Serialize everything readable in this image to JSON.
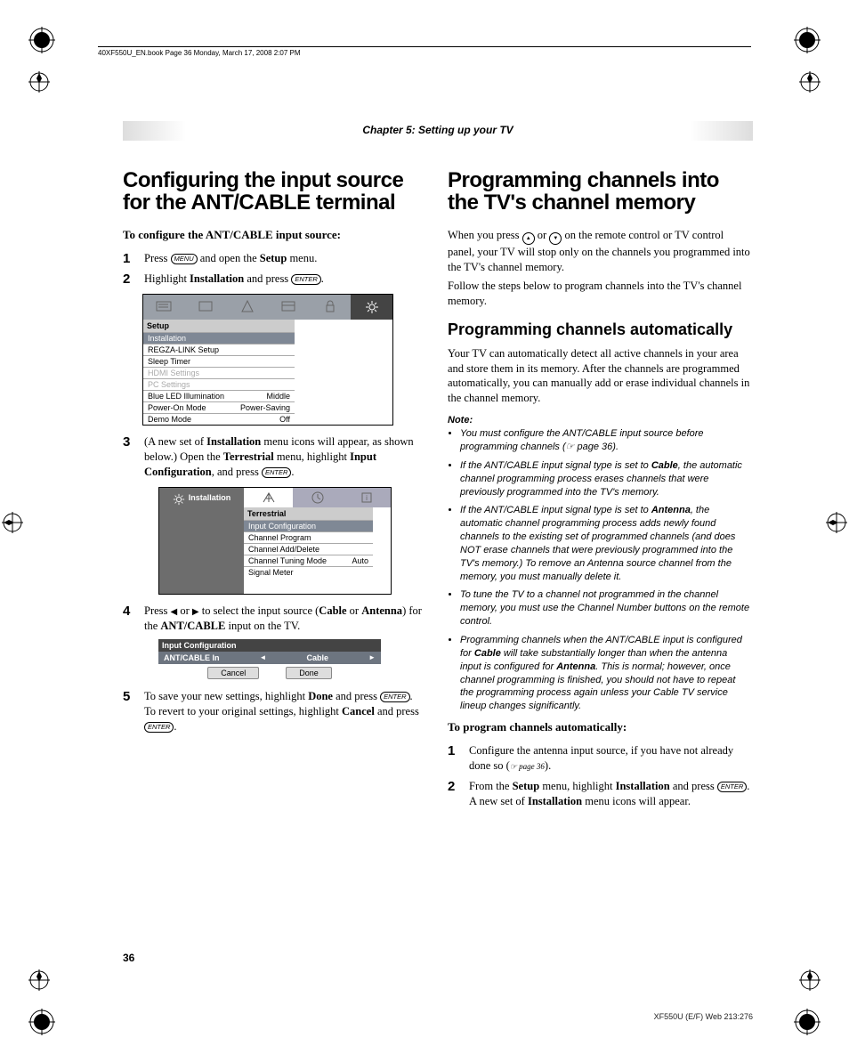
{
  "header": {
    "crop_text": "40XF550U_EN.book  Page 36  Monday, March 17, 2008  2:07 PM",
    "chapter": "Chapter 5: Setting up your TV"
  },
  "left": {
    "h1": "Configuring the input source for the ANT/CABLE terminal",
    "lede": "To configure the ANT/CABLE input source:",
    "step1_a": "Press ",
    "step1_menu": "MENU",
    "step1_b": " and open the ",
    "step1_bold": "Setup",
    "step1_c": " menu.",
    "step2_a": "Highlight ",
    "step2_bold": "Installation",
    "step2_b": " and press ",
    "step2_enter": "ENTER",
    "step2_c": ".",
    "menu1": {
      "title": "Setup",
      "rows": [
        {
          "l": "Installation",
          "r": "",
          "hl": true
        },
        {
          "l": "REGZA-LINK Setup",
          "r": ""
        },
        {
          "l": "Sleep Timer",
          "r": ""
        },
        {
          "l": "HDMI Settings",
          "r": "",
          "dim": true
        },
        {
          "l": "PC Settings",
          "r": "",
          "dim": true
        },
        {
          "l": "Blue LED Illumination",
          "r": "Middle"
        },
        {
          "l": "Power-On Mode",
          "r": "Power-Saving"
        },
        {
          "l": "Demo Mode",
          "r": "Off"
        }
      ]
    },
    "step3_a": "(A new set of ",
    "step3_b1": "Installation",
    "step3_b": " menu icons will appear, as shown below.) Open the ",
    "step3_b2": "Terrestrial",
    "step3_c": " menu, highlight ",
    "step3_b3": "Input Configuration",
    "step3_d": ", and press ",
    "step3_enter": "ENTER",
    "step3_e": ".",
    "menu2": {
      "side": "Installation",
      "title": "Terrestrial",
      "rows": [
        {
          "l": "Input Configuration",
          "r": "",
          "hl": true
        },
        {
          "l": "Channel Program",
          "r": ""
        },
        {
          "l": "Channel Add/Delete",
          "r": ""
        },
        {
          "l": "Channel Tuning Mode",
          "r": "Auto"
        },
        {
          "l": "Signal Meter",
          "r": ""
        }
      ]
    },
    "step4_a": "Press ",
    "step4_b": " or ",
    "step4_c": " to select the input source (",
    "step4_cable": "Cable",
    "step4_d": " or ",
    "step4_ant": "Antenna",
    "step4_e": ") for the ",
    "step4_f": "ANT/CABLE",
    "step4_g": " input on the TV.",
    "ic": {
      "head": "Input Configuration",
      "label": "ANT/CABLE In",
      "value": "Cable",
      "cancel": "Cancel",
      "done": "Done"
    },
    "step5_a": "To save your new settings, highlight ",
    "step5_done": "Done",
    "step5_b": " and press ",
    "step5_enter": "ENTER",
    "step5_c": ". To revert to your original settings, highlight ",
    "step5_cancel": "Cancel",
    "step5_d": " and press ",
    "step5_enter2": "ENTER",
    "step5_e": "."
  },
  "right": {
    "h1": "Programming channels into the TV's channel memory",
    "p1_a": "When you press ",
    "p1_b": " or ",
    "p1_c": " on the remote control or TV control panel, your TV will stop only on the channels you programmed into the TV's channel memory.",
    "p2": "Follow the steps below to program channels into the TV's channel memory.",
    "h2": "Programming channels automatically",
    "p3": "Your TV can automatically detect all active channels in your area and store them in its memory. After the channels are programmed automatically, you can manually add or erase individual channels in the channel memory.",
    "note_head": "Note:",
    "notes": [
      "You must configure the ANT/CABLE input source before programming channels (☞ page 36).",
      "If the ANT/CABLE input signal type is set to <b>Cable</b>, the automatic channel programming process erases channels that were previously programmed into the TV's memory.",
      "If the ANT/CABLE input signal type is set to <b>Antenna</b>, the automatic channel programming process adds newly found channels to the existing set of programmed channels (and does NOT erase channels that were previously programmed into the TV's memory.) To remove an Antenna source channel from the memory, you must manually delete it.",
      "To tune the TV to a channel not programmed in the channel memory, you must use the Channel Number buttons on the remote control.",
      "Programming channels when the ANT/CABLE input is configured for <b>Cable</b> will take substantially longer than when the antenna input is configured for <b>Antenna</b>. This is normal; however, once channel programming is finished, you should not have to repeat the programming process again unless your Cable TV service lineup changes significantly."
    ],
    "lede2": "To program channels automatically:",
    "rstep1_a": "Configure the antenna input source, if you have not already done so (",
    "rstep1_ref": "☞ page 36",
    "rstep1_b": ").",
    "rstep2_a": "From the ",
    "rstep2_setup": "Setup",
    "rstep2_b": " menu, highlight ",
    "rstep2_inst": "Installation",
    "rstep2_c": " and press ",
    "rstep2_enter": "ENTER",
    "rstep2_d": ". A new set of ",
    "rstep2_inst2": "Installation",
    "rstep2_e": " menu icons will appear."
  },
  "page_number": "36",
  "footer": "XF550U (E/F) Web 213:276"
}
